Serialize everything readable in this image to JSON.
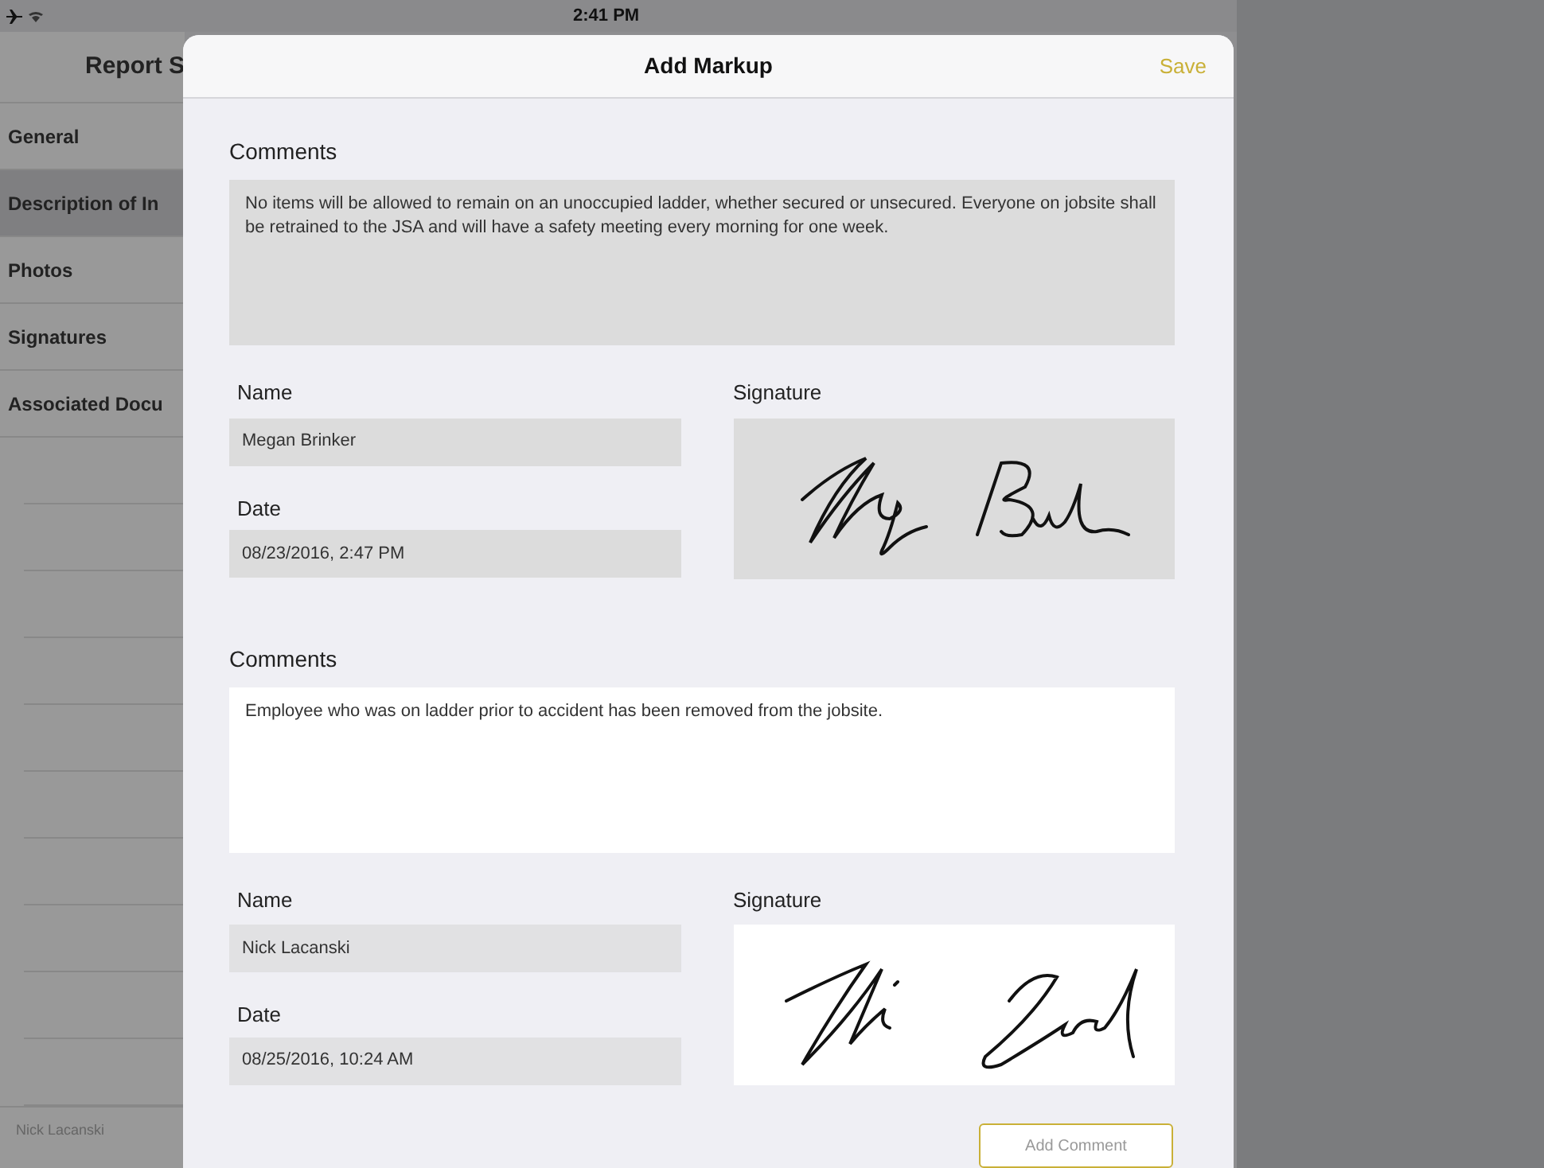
{
  "status_bar": {
    "time": "2:41 PM"
  },
  "sidebar": {
    "title": "Report S",
    "items": [
      {
        "label": "General",
        "selected": false
      },
      {
        "label": "Description of In",
        "selected": true
      },
      {
        "label": "Photos",
        "selected": false
      },
      {
        "label": "Signatures",
        "selected": false
      },
      {
        "label": "Associated Docu",
        "selected": false
      }
    ],
    "footer": "Nick Lacanski"
  },
  "modal": {
    "title": "Add Markup",
    "save": "Save",
    "entries": [
      {
        "comments_label": "Comments",
        "comments": "No items will be allowed to remain on an unoccupied ladder, whether secured or unsecured. Everyone on jobsite shall be retrained to the JSA and will have a safety meeting every morning for one week.",
        "name_label": "Name",
        "name": "Megan Brinker",
        "date_label": "Date",
        "date": "08/23/2016, 2:47 PM",
        "signature_label": "Signature",
        "disabled": true
      },
      {
        "comments_label": "Comments",
        "comments": "Employee who was on ladder prior to accident has been removed from the jobsite.",
        "name_label": "Name",
        "name": "Nick Lacanski",
        "date_label": "Date",
        "date": "08/25/2016, 10:24 AM",
        "signature_label": "Signature",
        "disabled": false
      }
    ],
    "add_button": "Add Comment"
  }
}
